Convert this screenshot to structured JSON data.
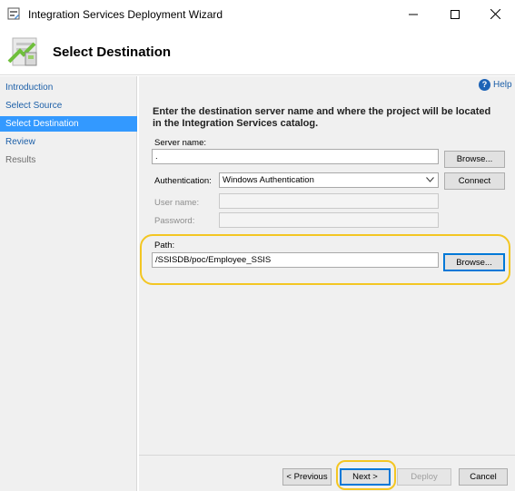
{
  "window": {
    "title": "Integration Services Deployment Wizard",
    "icon": "wizard-app-icon"
  },
  "header": {
    "title": "Select Destination",
    "icon": "deployment-wizard-graphic"
  },
  "nav": {
    "items": [
      {
        "label": "Introduction",
        "state": "link"
      },
      {
        "label": "Select Source",
        "state": "link"
      },
      {
        "label": "Select Destination",
        "state": "selected"
      },
      {
        "label": "Review",
        "state": "link"
      },
      {
        "label": "Results",
        "state": "disabled"
      }
    ]
  },
  "help": {
    "label": "Help"
  },
  "instructions": "Enter the destination server name and where the project will be located in the Integration Services catalog.",
  "server": {
    "label": "Server name:",
    "value": ".",
    "browse_label": "Browse..."
  },
  "authentication": {
    "label": "Authentication:",
    "value": "Windows Authentication",
    "connect_label": "Connect"
  },
  "username": {
    "label": "User name:",
    "value": ""
  },
  "password": {
    "label": "Password:",
    "value": ""
  },
  "path": {
    "label": "Path:",
    "value": "/SSISDB/poc/Employee_SSIS",
    "browse_label": "Browse..."
  },
  "footer": {
    "previous_label": "< Previous",
    "next_label": "Next >",
    "deploy_label": "Deploy",
    "cancel_label": "Cancel"
  },
  "colors": {
    "selected_nav": "#3399ff",
    "link": "#1c5fa8",
    "highlight": "#f3c623"
  }
}
